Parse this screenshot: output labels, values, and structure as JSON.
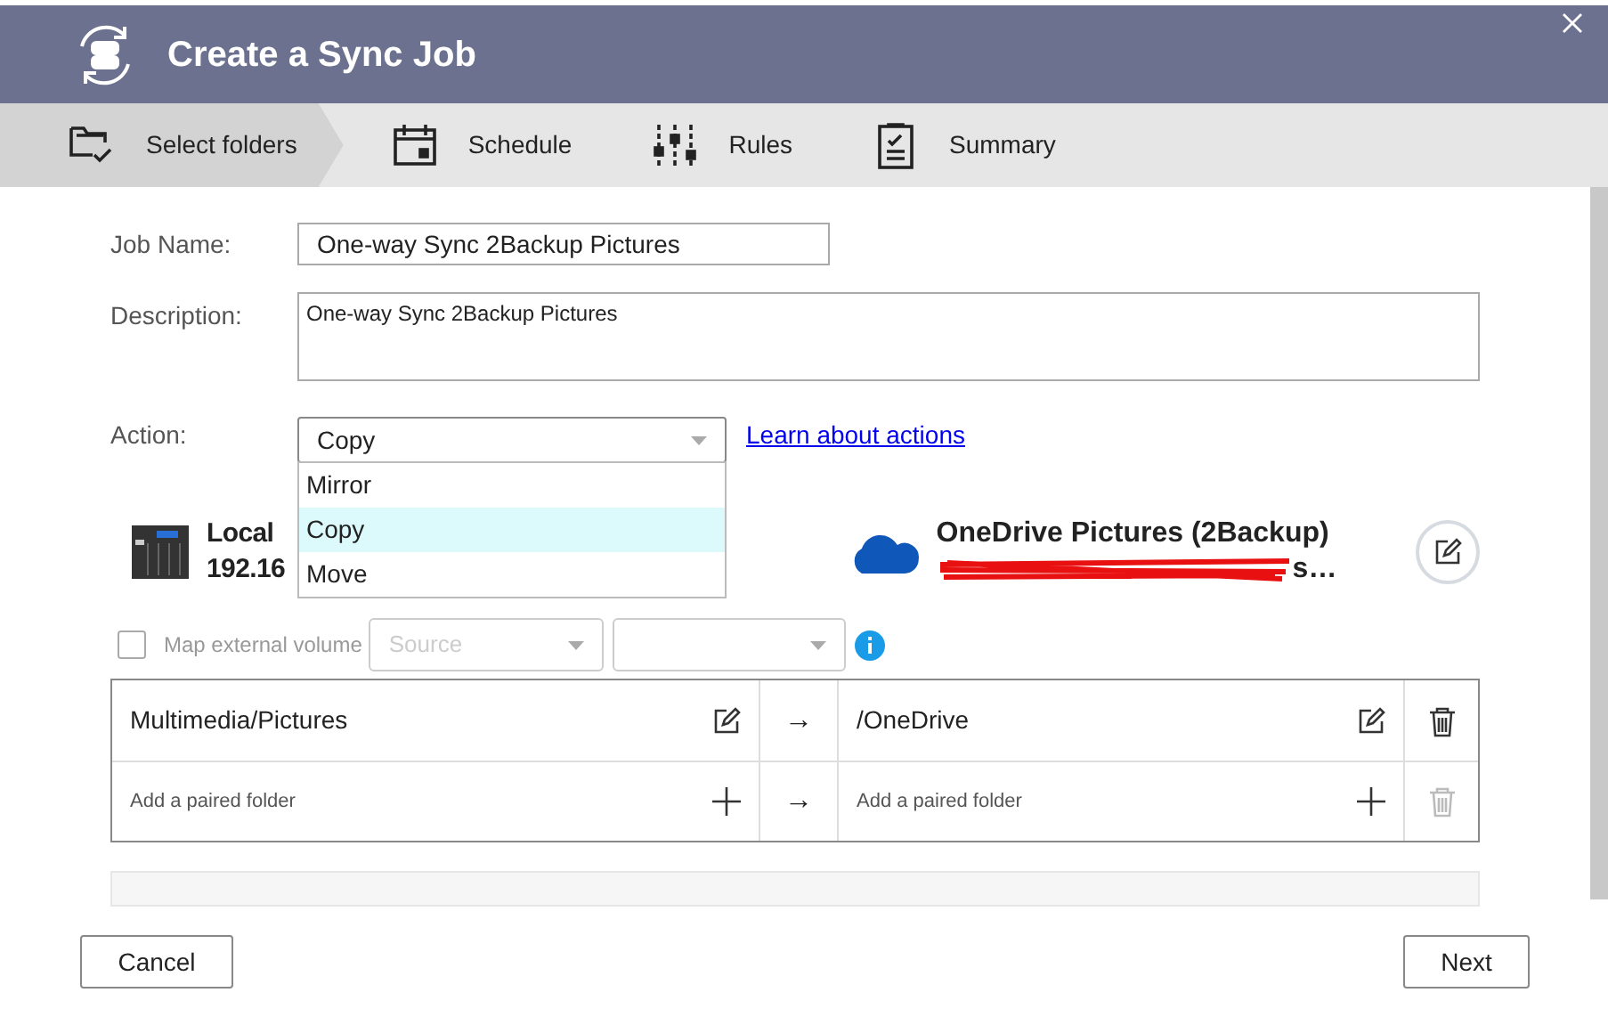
{
  "window": {
    "title": "Create a Sync Job"
  },
  "steps": [
    {
      "label": "Select folders",
      "selected": true,
      "kind": "folders"
    },
    {
      "label": "Schedule",
      "selected": false,
      "kind": "schedule"
    },
    {
      "label": "Rules",
      "selected": false,
      "kind": "rules"
    },
    {
      "label": "Summary",
      "selected": false,
      "kind": "summary"
    }
  ],
  "job_name": {
    "label": "Job Name:",
    "value": "One-way Sync 2Backup Pictures"
  },
  "description": {
    "label": "Description:",
    "value": "One-way Sync 2Backup Pictures"
  },
  "action": {
    "label": "Action:",
    "value": "Copy",
    "link": "Learn about actions",
    "options": [
      {
        "label": "Mirror",
        "selected": false
      },
      {
        "label": "Copy",
        "selected": true
      },
      {
        "label": "Move",
        "selected": false
      }
    ]
  },
  "source": {
    "name": "Local",
    "address": "192.16"
  },
  "destination": {
    "name": "OneDrive Pictures (2Backup)",
    "account_tail": "s…"
  },
  "external_volume": {
    "label": "Map external volume",
    "checked": false,
    "source_placeholder": "Source"
  },
  "pairs": [
    {
      "source": "Multimedia/Pictures",
      "arrow": "→",
      "destination": "/OneDrive",
      "kind": "folder"
    },
    {
      "source": "Add a paired folder",
      "arrow": "→",
      "destination": "Add a paired folder",
      "kind": "add"
    }
  ],
  "buttons": {
    "cancel": "Cancel",
    "next": "Next"
  }
}
